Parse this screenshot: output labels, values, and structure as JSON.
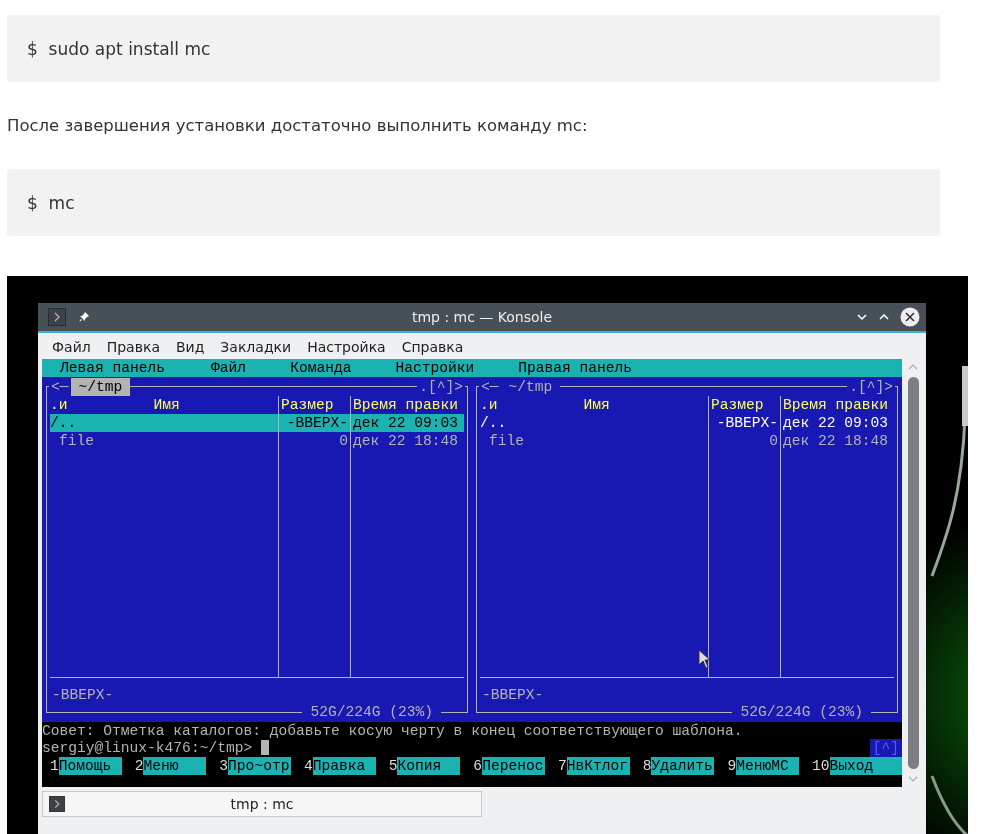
{
  "code_block_1": {
    "prompt": "$",
    "command": "sudo apt install mc"
  },
  "paragraph": "После завершения установки достаточно выполнить команду mc:",
  "code_block_2": {
    "prompt": "$",
    "command": "mc"
  },
  "screenshot": {
    "window_title": "tmp : mc — Konsole",
    "menu": [
      "Файл",
      "Правка",
      "Вид",
      "Закладки",
      "Настройка",
      "Справка"
    ],
    "mc_menu": [
      "Левая панель",
      "Файл",
      "Команда",
      "Настройки",
      "Правая панель"
    ],
    "panels": [
      {
        "nav_left": "<─",
        "path": "~/tmp",
        "active": true,
        "nav_right": ".[^]>",
        "sort_mark": ".и",
        "columns": [
          "Имя",
          "Размер",
          "Время правки"
        ],
        "rows": [
          {
            "kind": "dir",
            "name": "/..",
            "size": "-ВВЕРХ-",
            "time": "дек 22 09:03",
            "selected": true
          },
          {
            "kind": "file",
            "name": "file",
            "size": "0",
            "time": "дек 22 18:48",
            "selected": false
          }
        ],
        "mini_status": "-ВВЕРХ-",
        "disk": "52G/224G (23%)"
      },
      {
        "nav_left": "<─",
        "path": "~/tmp",
        "active": false,
        "nav_right": ".[^]>",
        "sort_mark": ".и",
        "columns": [
          "Имя",
          "Размер",
          "Время правки"
        ],
        "rows": [
          {
            "kind": "dir",
            "name": "/..",
            "size": "-ВВЕРХ-",
            "time": "дек 22 09:03",
            "selected": false
          },
          {
            "kind": "file",
            "name": "file",
            "size": "0",
            "time": "дек 22 18:48",
            "selected": false
          }
        ],
        "mini_status": "-ВВЕРХ-",
        "disk": "52G/224G (23%)"
      }
    ],
    "hint": "Совет: Отметка каталогов: добавьте косую черту в конец соответствующего шаблона.",
    "prompt": "sergiy@linux-k476:~/tmp>",
    "history_button": "[^]",
    "fkeys": [
      {
        "key": "1",
        "label": "Помощь"
      },
      {
        "key": "2",
        "label": "Меню"
      },
      {
        "key": "3",
        "label": "Про~отр"
      },
      {
        "key": "4",
        "label": "Правка"
      },
      {
        "key": "5",
        "label": "Копия"
      },
      {
        "key": "6",
        "label": "Перенос"
      },
      {
        "key": "7",
        "label": "НвКтлог"
      },
      {
        "key": "8",
        "label": "Удалить"
      },
      {
        "key": "9",
        "label": "МенюMC"
      },
      {
        "key": "10",
        "label": "Выход"
      }
    ],
    "tab": "tmp : mc"
  }
}
